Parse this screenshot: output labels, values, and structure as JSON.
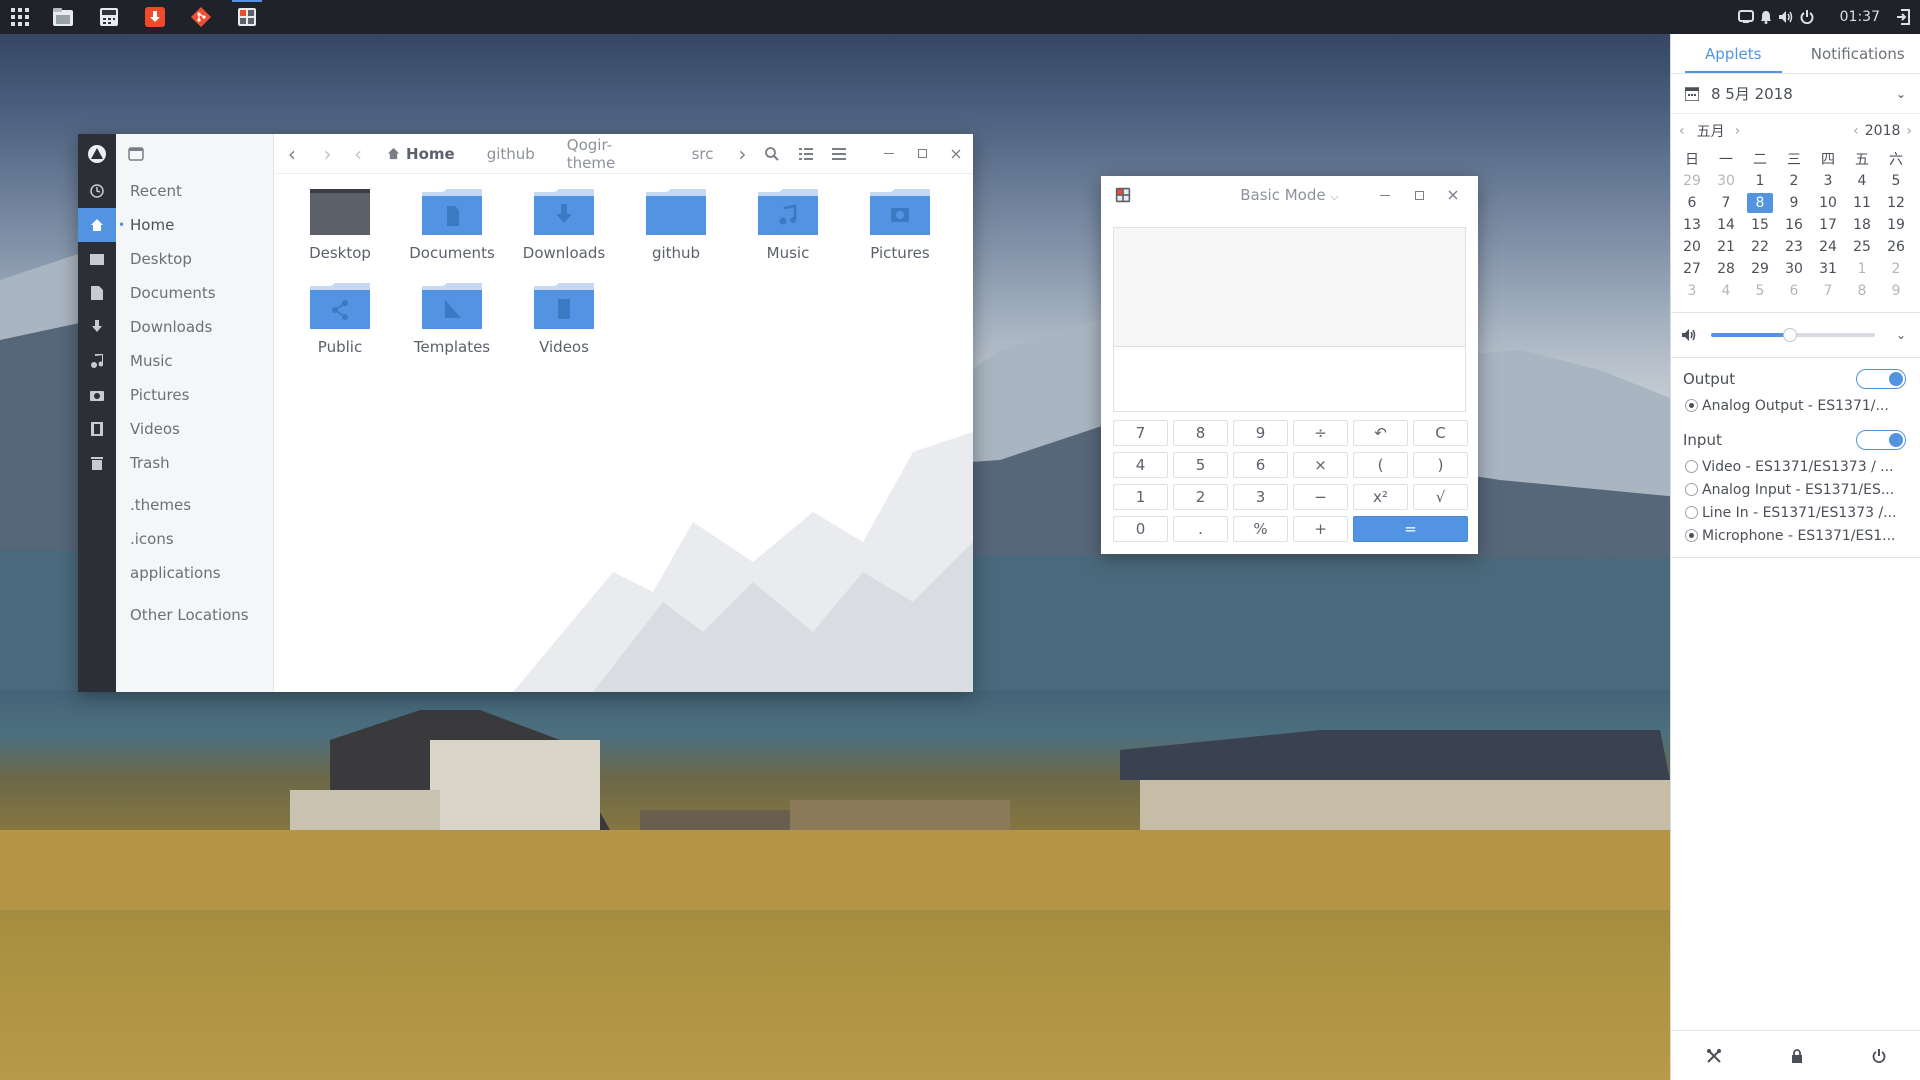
{
  "topbar": {
    "clock": "01:37",
    "apps": [
      "files-icon",
      "calculator-icon",
      "download-icon",
      "git-icon",
      "calc-window-icon"
    ]
  },
  "files": {
    "sidebar": [
      {
        "label": "Recent",
        "icon": "clock-icon"
      },
      {
        "label": "Home",
        "icon": "home-icon",
        "selected": true
      },
      {
        "label": "Desktop",
        "icon": "desktop-folder-icon"
      },
      {
        "label": "Documents",
        "icon": "document-icon"
      },
      {
        "label": "Downloads",
        "icon": "download-arrow-icon"
      },
      {
        "label": "Music",
        "icon": "music-note-icon"
      },
      {
        "label": "Pictures",
        "icon": "camera-icon"
      },
      {
        "label": "Videos",
        "icon": "film-icon"
      },
      {
        "label": "Trash",
        "icon": "trash-icon"
      },
      {
        "label": ".themes",
        "icon": "folder-icon"
      },
      {
        "label": ".icons",
        "icon": "folder-icon"
      },
      {
        "label": "applications",
        "icon": "folder-icon"
      },
      {
        "label": "Other Locations",
        "icon": "plus-icon"
      }
    ],
    "breadcrumbs": [
      "Home",
      "github",
      "Qogir-theme",
      "src"
    ],
    "folders": [
      "Desktop",
      "Documents",
      "Downloads",
      "github",
      "Music",
      "Pictures",
      "Public",
      "Templates",
      "Videos"
    ]
  },
  "calculator": {
    "mode": "Basic Mode",
    "keys": [
      "7",
      "8",
      "9",
      "÷",
      "↶",
      "C",
      "4",
      "5",
      "6",
      "×",
      "(",
      ")",
      "1",
      "2",
      "3",
      "−",
      "x²",
      "√",
      "0",
      ".",
      "%",
      "+",
      "="
    ]
  },
  "panel": {
    "tabs": [
      "Applets",
      "Notifications"
    ],
    "date": "8 5月 2018",
    "month": "五月",
    "year": "2018",
    "weekdays": [
      "日",
      "一",
      "二",
      "三",
      "四",
      "五",
      "六"
    ],
    "days": [
      [
        "29",
        "30",
        "1",
        "2",
        "3",
        "4",
        "5"
      ],
      [
        "6",
        "7",
        "8",
        "9",
        "10",
        "11",
        "12"
      ],
      [
        "13",
        "14",
        "15",
        "16",
        "17",
        "18",
        "19"
      ],
      [
        "20",
        "21",
        "22",
        "23",
        "24",
        "25",
        "26"
      ],
      [
        "27",
        "28",
        "29",
        "30",
        "31",
        "1",
        "2"
      ],
      [
        "3",
        "4",
        "5",
        "6",
        "7",
        "8",
        "9"
      ]
    ],
    "selected_day": "8",
    "volume_level": 0.48,
    "output_label": "Output",
    "output_devices": [
      {
        "label": "Analog Output - ES1371/...",
        "checked": true
      }
    ],
    "input_label": "Input",
    "input_devices": [
      {
        "label": "Video - ES1371/ES1373 / ...",
        "checked": false
      },
      {
        "label": "Analog Input - ES1371/ES...",
        "checked": false
      },
      {
        "label": "Line In - ES1371/ES1373 /...",
        "checked": false
      },
      {
        "label": "Microphone - ES1371/ES1...",
        "checked": true
      }
    ]
  },
  "colors": {
    "accent": "#5294e2",
    "topbar": "#1f2228",
    "folder": "#5294e2"
  }
}
